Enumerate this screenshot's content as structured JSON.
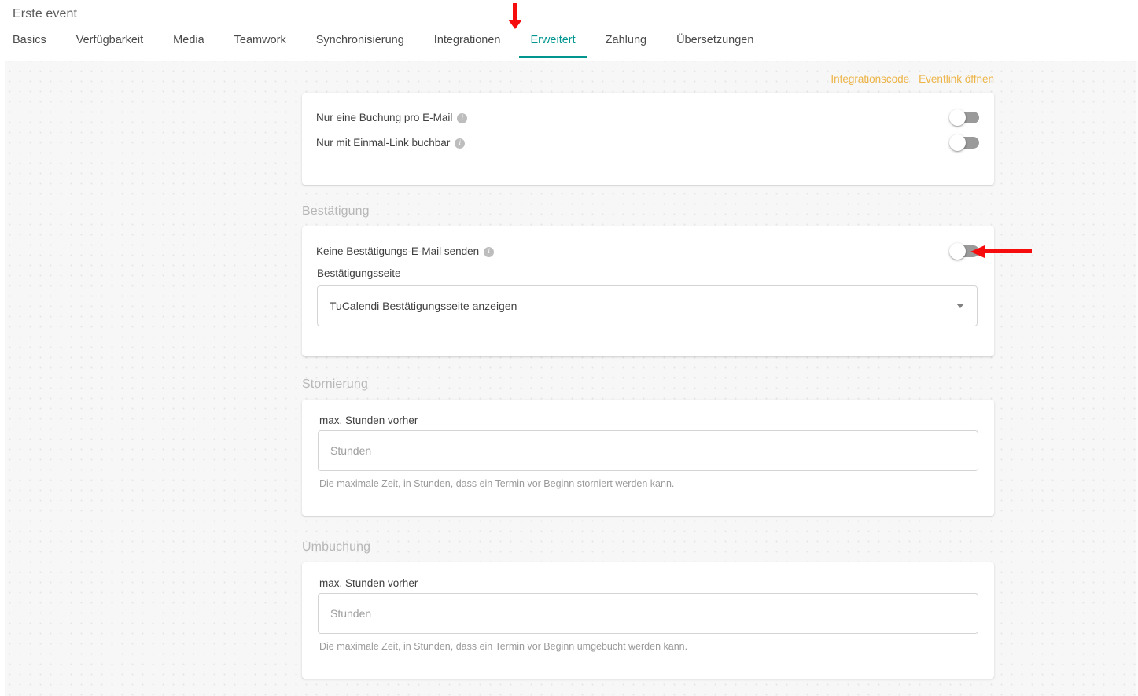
{
  "header": {
    "page_title": "Erste event",
    "tabs": [
      {
        "label": "Basics",
        "active": false
      },
      {
        "label": "Verfügbarkeit",
        "active": false
      },
      {
        "label": "Media",
        "active": false
      },
      {
        "label": "Teamwork",
        "active": false
      },
      {
        "label": "Synchronisierung",
        "active": false
      },
      {
        "label": "Integrationen",
        "active": false
      },
      {
        "label": "Erweitert",
        "active": true
      },
      {
        "label": "Zahlung",
        "active": false
      },
      {
        "label": "Übersetzungen",
        "active": false
      }
    ]
  },
  "toplinks": {
    "integration_code": "Integrationscode",
    "open_eventlink": "Eventlink öffnen",
    "color": "#edb447"
  },
  "options_card": {
    "rows": [
      {
        "label": "Nur eine Buchung pro E-Mail",
        "info": "i",
        "toggle_on": false
      },
      {
        "label": "Nur mit Einmal-Link buchbar",
        "info": "i",
        "toggle_on": false
      }
    ]
  },
  "confirmation": {
    "section_title": "Bestätigung",
    "toggle_label": "Keine Bestätigungs-E-Mail senden",
    "toggle_info": "i",
    "toggle_on": false,
    "select_label": "Bestätigungsseite",
    "select_value": "TuCalendi Bestätigungsseite anzeigen",
    "select_options": [
      "TuCalendi Bestätigungsseite anzeigen"
    ]
  },
  "cancellation": {
    "section_title": "Stornierung",
    "field_label": "max. Stunden vorher",
    "input_value": "",
    "input_placeholder": "Stunden",
    "help_text": "Die maximale Zeit, in Stunden, dass ein Termin vor Beginn storniert werden kann."
  },
  "rebooking": {
    "section_title": "Umbuchung",
    "field_label": "max. Stunden vorher",
    "input_value": "",
    "input_placeholder": "Stunden",
    "help_text": "Die maximale Zeit, in Stunden, dass ein Termin vor Beginn umgebucht werden kann."
  },
  "annotations": {
    "color": "#f60c0c",
    "arrow_down_target": "Erweitert",
    "arrow_left_target": "Keine Bestätigungs-E-Mail senden"
  },
  "theme": {
    "accent": "#00968f",
    "link": "#edb447",
    "page_background": "#f7f7f7",
    "card_background": "#ffffff"
  }
}
